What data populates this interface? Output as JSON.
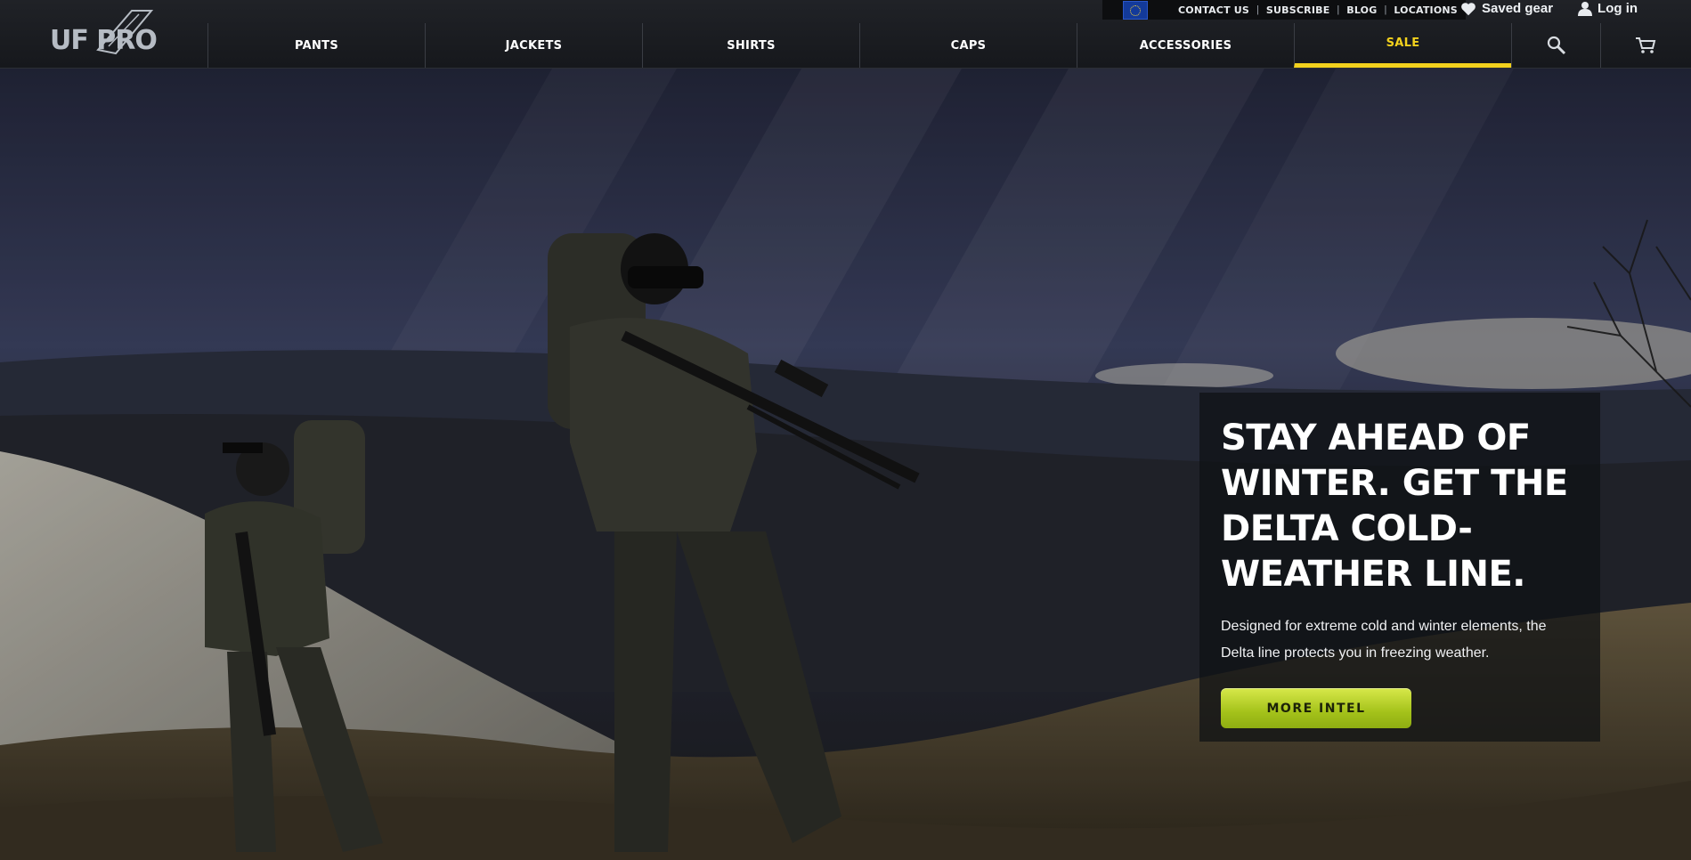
{
  "brand": {
    "logo_text": "UF PRO",
    "logo_icon": "uf-pro-blade-logo"
  },
  "utility_nav": {
    "region_flag": "eu-flag-icon",
    "links": [
      "CONTACT US",
      "SUBSCRIBE",
      "BLOG",
      "LOCATIONS"
    ]
  },
  "account": {
    "saved_gear_label": "Saved gear",
    "saved_gear_icon": "heart-icon",
    "login_label": "Log in",
    "login_icon": "user-icon"
  },
  "main_nav": {
    "items": [
      "PANTS",
      "JACKETS",
      "SHIRTS",
      "CAPS",
      "ACCESSORIES",
      "SALE"
    ],
    "active": "SALE",
    "search_icon": "search-icon",
    "cart_icon": "cart-icon"
  },
  "hero": {
    "title": "STAY AHEAD OF WINTER. GET THE DELTA COLD-WEATHER LINE.",
    "description": "Designed for extreme cold and winter elements, the Delta line protects you in freezing weather.",
    "button_label": "MORE INTEL"
  },
  "colors": {
    "accent_yellow": "#f2d11d",
    "button_green": "#a4c21a",
    "header_bg": "#1b1d21"
  }
}
